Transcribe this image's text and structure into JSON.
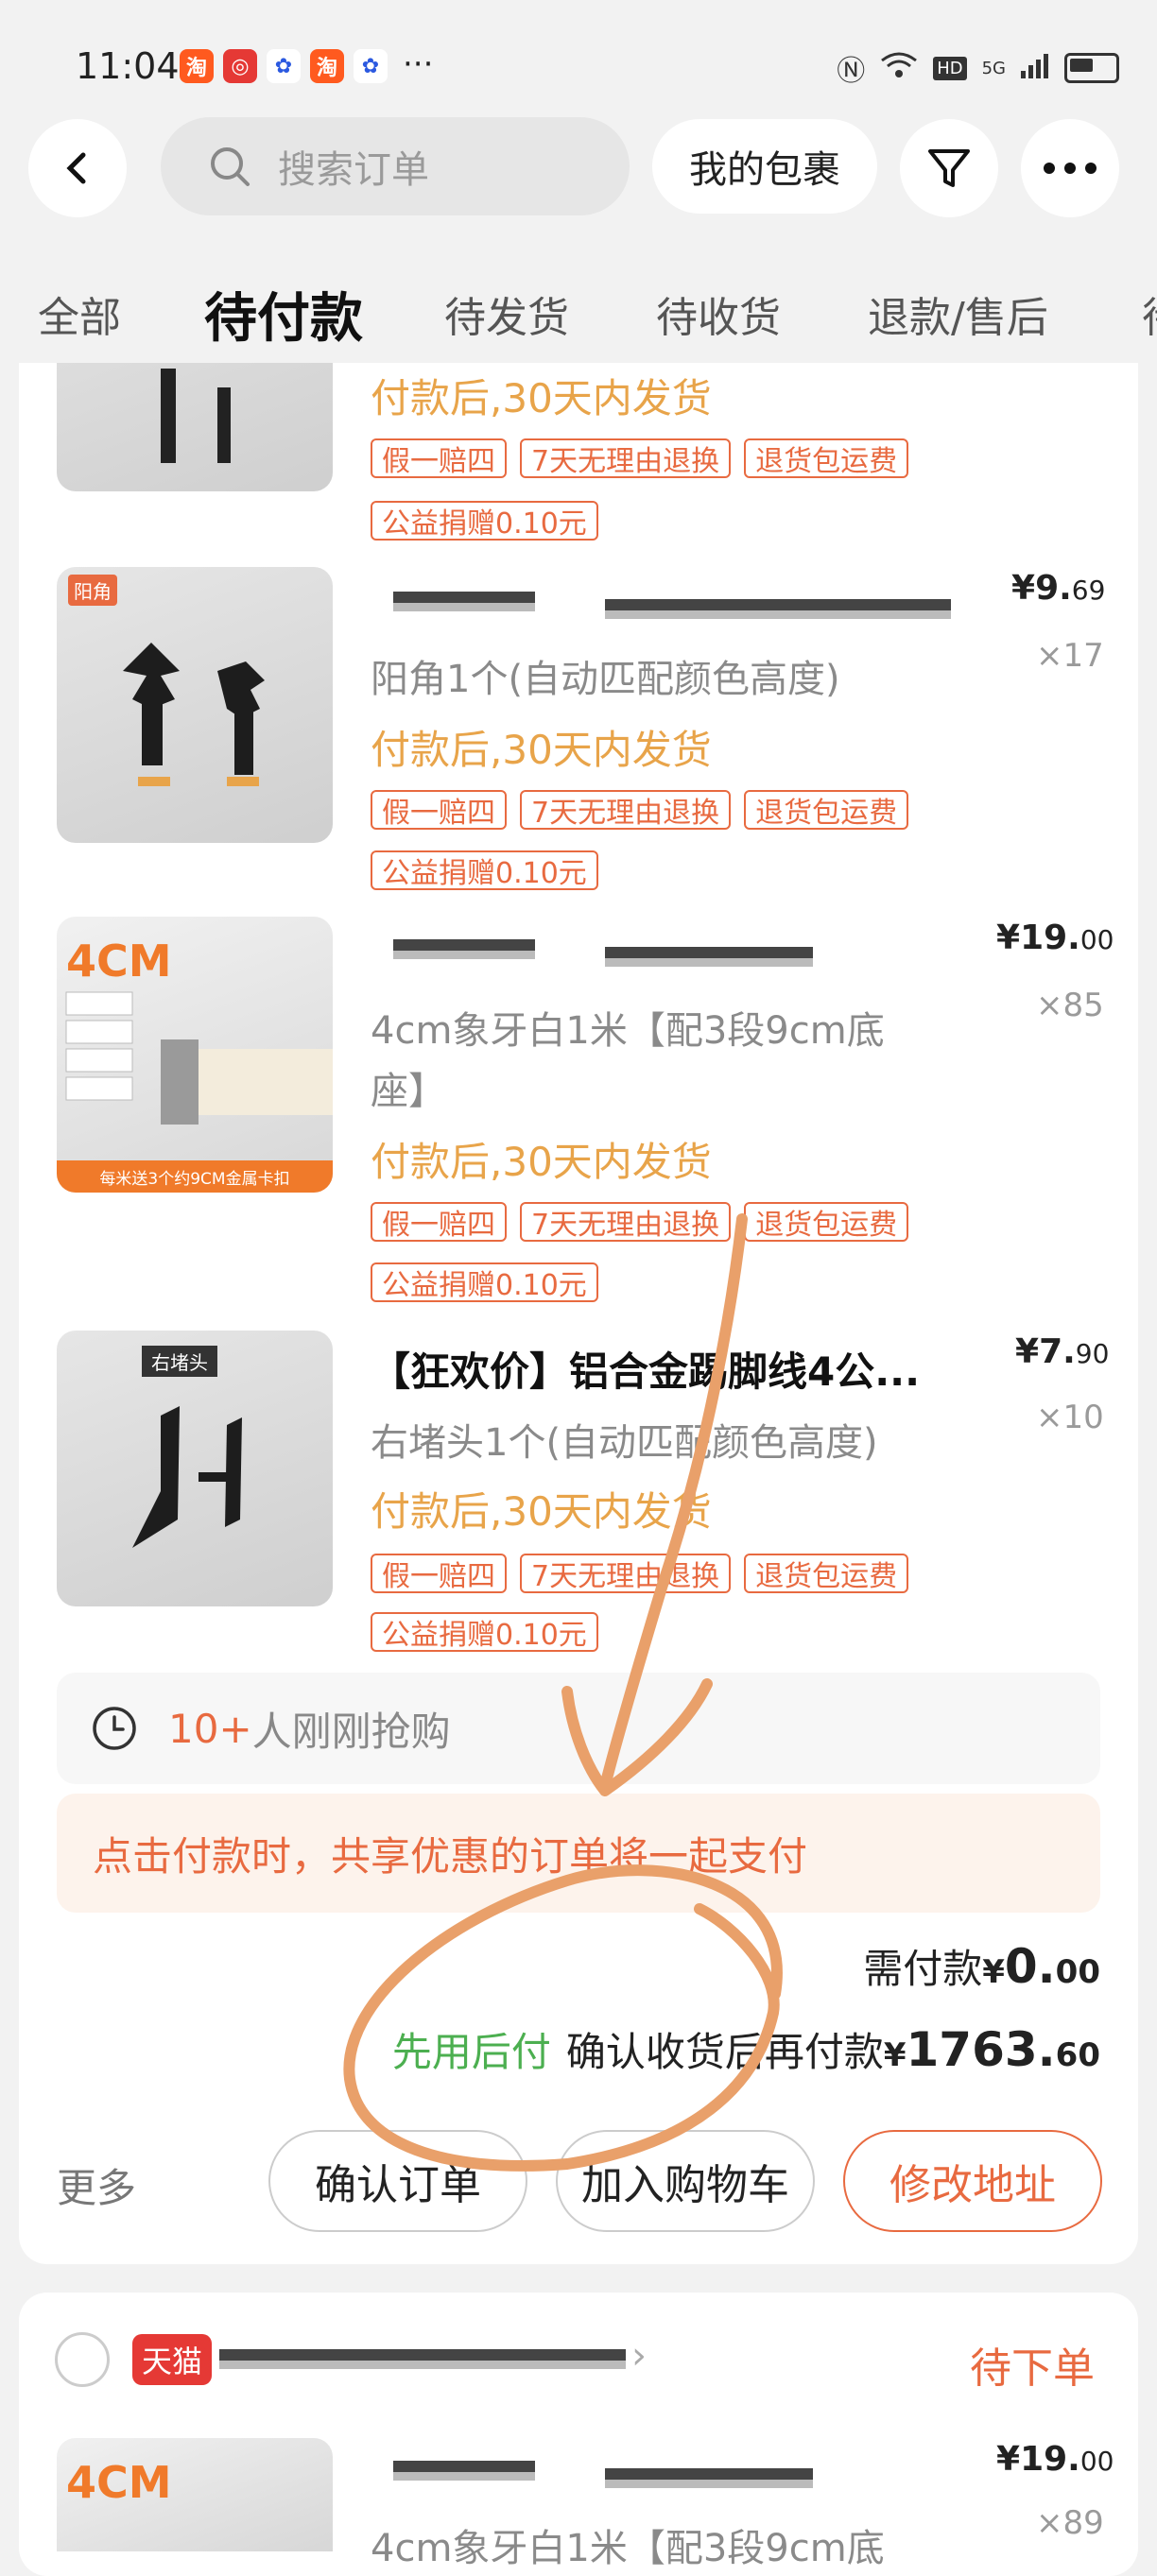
{
  "status": {
    "time": "11:04",
    "more": "···",
    "icons": [
      "taobao-icon",
      "app2-icon",
      "baidu-icon",
      "tao-icon",
      "baidu-icon"
    ],
    "signal_label": "5G",
    "hd_label": "HD"
  },
  "header": {
    "search_placeholder": "搜索订单",
    "packages_label": "我的包裹"
  },
  "tabs": [
    "全部",
    "待付款",
    "待发货",
    "待收货",
    "退款/售后"
  ],
  "active_tab": 1,
  "items": [
    {
      "ship": "付款后,30天内发货",
      "tags": [
        "假一赔四",
        "7天无理由退换",
        "退货包运费"
      ],
      "donation": "公益捐赠0.10元"
    },
    {
      "thumb_label": "阳角",
      "variant": "阳角1个(自动匹配颜色高度)",
      "ship": "付款后,30天内发货",
      "tags": [
        "假一赔四",
        "7天无理由退换",
        "退货包运费"
      ],
      "donation": "公益捐赠0.10元",
      "price_int": "9.",
      "price_dec": "69",
      "price_sym": "¥",
      "qty": "×17"
    },
    {
      "thumb_label": "4CM",
      "variant_line1": "4cm象牙白1米【配3段9cm底",
      "variant_line2": "座】",
      "ship": "付款后,30天内发货",
      "tags": [
        "假一赔四",
        "7天无理由退换",
        "退货包运费"
      ],
      "donation": "公益捐赠0.10元",
      "price_int": "19.",
      "price_dec": "00",
      "price_sym": "¥",
      "qty": "×85",
      "thumb_caption": "每米送3个约9CM金属卡扣"
    },
    {
      "thumb_label": "右堵头",
      "title": "【狂欢价】铝合金踢脚线4公...",
      "variant": "右堵头1个(自动匹配颜色高度)",
      "ship": "付款后,30天内发货",
      "tags": [
        "假一赔四",
        "7天无理由退换",
        "退货包运费"
      ],
      "donation": "公益捐赠0.10元",
      "price_int": "7.",
      "price_dec": "90",
      "price_sym": "¥",
      "qty": "×10"
    }
  ],
  "rush": {
    "count": "10+",
    "text": "人刚刚抢购"
  },
  "notice": "点击付款时，共享优惠的订单将一起支付",
  "pay": {
    "label": "需付款",
    "sym": "¥",
    "int": "0.",
    "dec": "00"
  },
  "later": {
    "tag": "先用后付",
    "text": "确认收货后再付款",
    "sym": "¥",
    "int": "1763.",
    "dec": "60"
  },
  "actions": {
    "more": "更多",
    "confirm": "确认订单",
    "cart": "加入购物车",
    "address": "修改地址"
  },
  "next_order": {
    "shop_badge": "天猫",
    "status": "待下单",
    "price_sym": "¥",
    "price_int": "19.",
    "price_dec": "00",
    "qty": "×89",
    "variant": "4cm象牙白1米【配3段9cm底",
    "thumb_label": "4CM"
  },
  "colors": {
    "accent": "#e86a40",
    "ship": "#e8a44a",
    "green": "#4caf50",
    "annotation": "#e9a06a"
  }
}
